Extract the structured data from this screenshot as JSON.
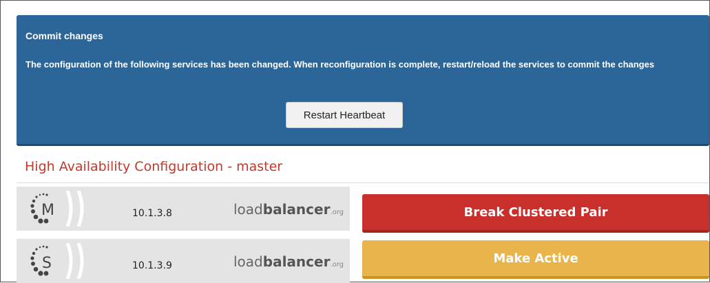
{
  "commit": {
    "title": "Commit changes",
    "message": "The configuration of the following services has been changed. When reconfiguration is complete, restart/reload the services to commit the changes",
    "restart_label": "Restart Heartbeat"
  },
  "ha": {
    "title": "High Availability Configuration - master"
  },
  "nodes": [
    {
      "role_letter": "M",
      "ip": "10.1.3.8",
      "brand": {
        "prefix": "load",
        "bold": "balancer",
        "suffix": ".org"
      }
    },
    {
      "role_letter": "S",
      "ip": "10.1.3.9",
      "brand": {
        "prefix": "load",
        "bold": "balancer",
        "suffix": ".org"
      }
    }
  ],
  "actions": {
    "break_label": "Break Clustered Pair",
    "make_active_label": "Make Active"
  },
  "colors": {
    "panel_blue": "#2c6698",
    "title_red": "#c0392b",
    "danger": "#c9302c",
    "warning": "#e9b54b"
  }
}
